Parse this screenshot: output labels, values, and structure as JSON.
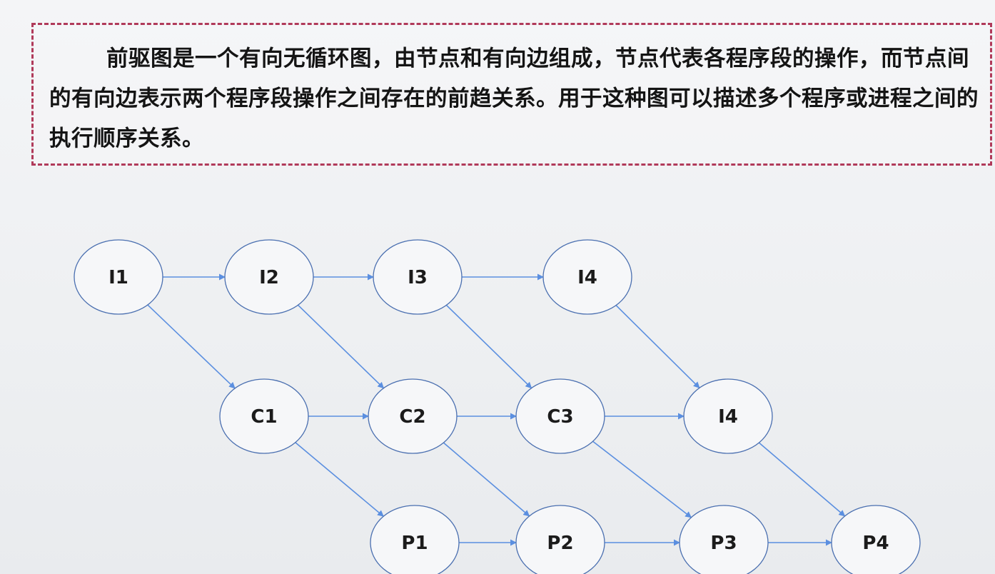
{
  "description": {
    "text": "前驱图是一个有向无循环图，由节点和有向边组成，节点代表各程序段的操作，而节点间的有向边表示两个程序段操作之间存在的前趋关系。用于这种图可以描述多个程序或进程之间的执行顺序关系。"
  },
  "colors": {
    "dashed_border": "#b03a5a",
    "node_stroke": "#4a6fb0",
    "edge": "#5b8fe0"
  },
  "diagram": {
    "nodes": [
      {
        "id": "I1",
        "label": "I1"
      },
      {
        "id": "I2",
        "label": "I2"
      },
      {
        "id": "I3",
        "label": "I3"
      },
      {
        "id": "I4a",
        "label": "I4"
      },
      {
        "id": "C1",
        "label": "C1"
      },
      {
        "id": "C2",
        "label": "C2"
      },
      {
        "id": "C3",
        "label": "C3"
      },
      {
        "id": "I4b",
        "label": "I4"
      },
      {
        "id": "P1",
        "label": "P1"
      },
      {
        "id": "P2",
        "label": "P2"
      },
      {
        "id": "P3",
        "label": "P3"
      },
      {
        "id": "P4",
        "label": "P4"
      }
    ],
    "edges": [
      [
        "I1",
        "I2"
      ],
      [
        "I2",
        "I3"
      ],
      [
        "I3",
        "I4a"
      ],
      [
        "I1",
        "C1"
      ],
      [
        "I2",
        "C2"
      ],
      [
        "I3",
        "C3"
      ],
      [
        "I4a",
        "I4b"
      ],
      [
        "C1",
        "C2"
      ],
      [
        "C2",
        "C3"
      ],
      [
        "C3",
        "I4b"
      ],
      [
        "C1",
        "P1"
      ],
      [
        "C2",
        "P2"
      ],
      [
        "C3",
        "P3"
      ],
      [
        "I4b",
        "P4"
      ],
      [
        "P1",
        "P2"
      ],
      [
        "P2",
        "P3"
      ],
      [
        "P3",
        "P4"
      ]
    ]
  }
}
